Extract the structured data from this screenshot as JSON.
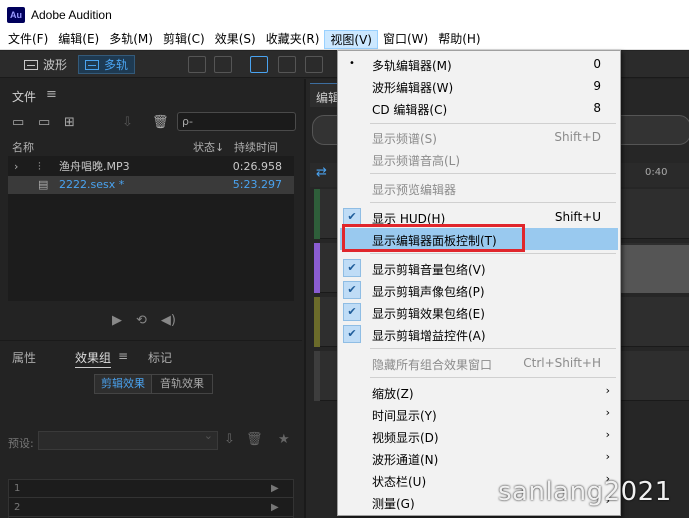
{
  "window": {
    "app_logo": "Au",
    "title": "Adobe Audition"
  },
  "menubar": [
    {
      "label": "文件(F)"
    },
    {
      "label": "编辑(E)"
    },
    {
      "label": "多轨(M)"
    },
    {
      "label": "剪辑(C)"
    },
    {
      "label": "效果(S)"
    },
    {
      "label": "收藏夹(R)"
    },
    {
      "label": "视图(V)"
    },
    {
      "label": "窗口(W)"
    },
    {
      "label": "帮助(H)"
    }
  ],
  "toolbar": {
    "waveform_label": "波形",
    "multitrack_label": "多轨"
  },
  "files_panel": {
    "title": "文件",
    "search_placeholder": "ρ-",
    "columns": {
      "name": "名称",
      "status": "状态↓",
      "duration": "持续时间"
    },
    "files": [
      {
        "name": "渔舟唱晚.MP3",
        "duration": "0:26.958"
      },
      {
        "name": "2222.sesx *",
        "duration": "5:23.297"
      }
    ]
  },
  "props_panel": {
    "tabs": {
      "properties": "属性",
      "effects": "效果组",
      "markers": "标记"
    },
    "sub_tabs": {
      "clip": "剪辑效果",
      "track": "音轨效果"
    },
    "preset_label": "预设:",
    "rack_rows": [
      "1",
      "2"
    ]
  },
  "editor": {
    "tab_label": "编辑",
    "ruler_mark": "0:40"
  },
  "view_menu": {
    "items": [
      {
        "label": "多轨编辑器(M)",
        "shortcut": "0",
        "marker": "•"
      },
      {
        "label": "波形编辑器(W)",
        "shortcut": "9"
      },
      {
        "label": "CD 编辑器(C)",
        "shortcut": "8"
      },
      {
        "label": "显示频谱(S)",
        "shortcut": "Shift+D",
        "disabled": true
      },
      {
        "label": "显示频谱音高(L)",
        "disabled": true
      },
      {
        "label": "显示预览编辑器",
        "disabled": true
      },
      {
        "label": "显示 HUD(H)",
        "shortcut": "Shift+U",
        "checked": true
      },
      {
        "label": "显示编辑器面板控制(T)",
        "highlighted": true
      },
      {
        "label": "显示剪辑音量包络(V)",
        "checked": true
      },
      {
        "label": "显示剪辑声像包络(P)",
        "checked": true
      },
      {
        "label": "显示剪辑效果包络(E)",
        "checked": true
      },
      {
        "label": "显示剪辑增益控件(A)",
        "checked": true
      },
      {
        "label": "隐藏所有组合效果窗口",
        "shortcut": "Ctrl+Shift+H",
        "disabled": true
      },
      {
        "label": "缩放(Z)",
        "submenu": true
      },
      {
        "label": "时间显示(Y)",
        "submenu": true
      },
      {
        "label": "视频显示(D)",
        "submenu": true
      },
      {
        "label": "波形通道(N)",
        "submenu": true
      },
      {
        "label": "状态栏(U)",
        "submenu": true
      },
      {
        "label": "测量(G)",
        "submenu": true
      }
    ],
    "check_glyph": "✔",
    "submenu_glyph": "›"
  },
  "watermark": "sanlang2021",
  "colors": {
    "accent": "#4aa3f0",
    "highlight_box": "#e0262c",
    "menu_highlight": "#99c9ef"
  }
}
